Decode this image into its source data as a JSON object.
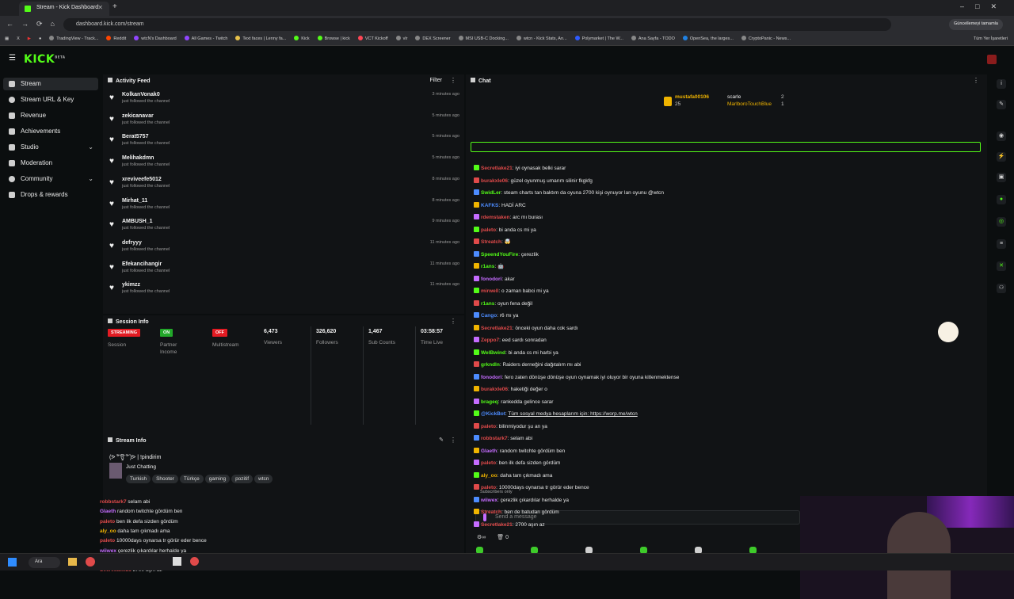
{
  "browser": {
    "tabs": [
      {
        "title": "Stream - Kick Dashboard"
      },
      {
        "title": "wtcN's Dashboard"
      }
    ],
    "url": "dashboard.kick.com/stream",
    "update_label": "Güncellemeyi tamamla",
    "bookmarks": [
      "TradingView - Track...",
      "Reddit",
      "wtcN's Dashboard",
      "All Games - Twitch",
      "Text faces | Lenny fa...",
      "Kick",
      "Browse | kick",
      "VCT Kickoff",
      "vlr",
      "DEX Screener",
      "MSI USB-C Docking...",
      "wtcn - Kick Stats, An...",
      "Polymarket | The W...",
      "Ana Sayfa - TODO",
      "OpenSea, the larges...",
      "CryptoPanic - News..."
    ],
    "all_bookmarks": "Tüm Yer İşaretleri"
  },
  "app": {
    "logo": "KICK",
    "logo_sup": "BETA"
  },
  "sidebar": {
    "items": [
      {
        "label": "Stream",
        "active": true
      },
      {
        "label": "Stream URL & Key"
      },
      {
        "label": "Revenue"
      },
      {
        "label": "Achievements"
      },
      {
        "label": "Studio",
        "chevron": true
      },
      {
        "label": "Moderation"
      },
      {
        "label": "Community",
        "chevron": true
      },
      {
        "label": "Drops & rewards"
      }
    ]
  },
  "activity": {
    "title": "Activity Feed",
    "filter": "Filter",
    "items": [
      {
        "name": "KolkanVonak0",
        "sub": "just followed the channel",
        "time": "3 minutes ago"
      },
      {
        "name": "zekicanavar",
        "sub": "just followed the channel",
        "time": "5 minutes ago"
      },
      {
        "name": "Berat5757",
        "sub": "just followed the channel",
        "time": "5 minutes ago"
      },
      {
        "name": "Melihakdmn",
        "sub": "just followed the channel",
        "time": "5 minutes ago"
      },
      {
        "name": "xreviveefe5012",
        "sub": "just followed the channel",
        "time": "8 minutes ago"
      },
      {
        "name": "Mirhat_11",
        "sub": "just followed the channel",
        "time": "8 minutes ago"
      },
      {
        "name": "AMBUSH_1",
        "sub": "just followed the channel",
        "time": "9 minutes ago"
      },
      {
        "name": "defryyy",
        "sub": "just followed the channel",
        "time": "11 minutes ago"
      },
      {
        "name": "Efekancihangir",
        "sub": "just followed the channel",
        "time": "11 minutes ago"
      },
      {
        "name": "ykimzz",
        "sub": "just followed the channel",
        "time": "11 minutes ago"
      }
    ]
  },
  "session": {
    "title": "Session Info",
    "stats": [
      {
        "badge": "STREAMING",
        "label": "Session",
        "color": "#e31b23"
      },
      {
        "badge": "ON",
        "label": "Partner Income",
        "color": "#22a82a"
      },
      {
        "badge": "OFF",
        "label": "Multistream",
        "color": "#e31b23"
      },
      {
        "value": "6,473",
        "label": "Viewers"
      },
      {
        "value": "326,620",
        "label": "Followers"
      },
      {
        "value": "1,467",
        "label": "Sub Counts"
      },
      {
        "value": "03:58:57",
        "label": "Time Live"
      }
    ]
  },
  "stream_info": {
    "title": "Stream Info",
    "stream_title": "(ᕗ ͠° ਊ ͠° )ᕗ | !pindirim",
    "category": "Just Chatting",
    "tags": [
      "Turkish",
      "Shooter",
      "Türkçe",
      "gaming",
      "pozitif",
      "wtcn"
    ]
  },
  "overlay_chat": [
    {
      "user": "robbstark7",
      "text": "selam abi",
      "color": "#e04a4a"
    },
    {
      "user": "Glaeth",
      "text": "random twitchte gördüm ben",
      "color": "#c56cff"
    },
    {
      "user": "paleto",
      "text": "ben ilk defa sizden gördüm",
      "color": "#e04a4a"
    },
    {
      "user": "aly_oo",
      "text": "daha tam çıkmadı ama",
      "color": "#f0b400"
    },
    {
      "user": "paleto",
      "text": "10000days oynarsa tr görür eder bence",
      "color": "#e04a4a"
    },
    {
      "user": "wiiwex",
      "text": "çerezlik çıkardılar herhalde ya",
      "color": "#c56cff"
    },
    {
      "user": "Streatch",
      "text": "ben de batudan gördüm",
      "color": "#e04a4a"
    },
    {
      "user": "Secretlake21",
      "text": "2700 aşın az",
      "color": "#e04a4a"
    }
  ],
  "chat": {
    "title": "Chat",
    "top_gifters": [
      {
        "name": "mustafa00106",
        "count": "25"
      },
      {
        "name": "scarle",
        "count": "2"
      },
      {
        "name": "MarlboroTouchBlue",
        "count": "1"
      }
    ],
    "messages": [
      {
        "user": "Secretlake21",
        "text": "iyi oynasak belki sarar",
        "color": "#e04a4a"
      },
      {
        "user": "burakxle06",
        "text": "güzel oyunmuş umarım silinir fkgkfg",
        "color": "#e04a4a"
      },
      {
        "user": "SwidLer",
        "text": "steam charts tan baktım da oyuna 2700 kişi oynuyor lan oyunu @wtcn",
        "color": "#53fc18",
        "highlight": true
      },
      {
        "user": "KAFKS",
        "text": "HADİ ARC",
        "color": "#4d8cff"
      },
      {
        "user": "rdemstaken",
        "text": "arc mı burası",
        "color": "#e04a4a"
      },
      {
        "user": "paleto",
        "text": "bi anda cs mi ya",
        "color": "#e04a4a"
      },
      {
        "user": "Streatch",
        "text": "🤯",
        "color": "#e04a4a"
      },
      {
        "user": "SpeendYouFire",
        "text": "çerezlik",
        "color": "#53fc18"
      },
      {
        "user": "r1ans",
        "text": "🤖",
        "color": "#53fc18"
      },
      {
        "user": "fonodori",
        "text": "akar",
        "color": "#c56cff"
      },
      {
        "user": "mirwell",
        "text": "o zaman babci mi ya",
        "color": "#e04a4a"
      },
      {
        "user": "r1ans",
        "text": "oyun fena değil",
        "color": "#53fc18"
      },
      {
        "user": "Cango",
        "text": "r6 mı ya",
        "color": "#4d8cff"
      },
      {
        "user": "Secretlake21",
        "text": "önceki oyun daha cok sardı",
        "color": "#e04a4a"
      },
      {
        "user": "Zeppo7",
        "text": "eed sardı sonradan",
        "color": "#e04a4a"
      },
      {
        "user": "WelBwind",
        "text": "bi anda cs mi harbi ya",
        "color": "#53fc18"
      },
      {
        "user": "grkndln",
        "text": "Raiders derneğini dağıtalım mı abi",
        "color": "#53fc18"
      },
      {
        "user": "fonodori",
        "text": "fero zaten dönüşe dönüşe oyun oynamak iyi oluyor bir oyuna kitlenmektense",
        "color": "#c56cff"
      },
      {
        "user": "burakxle06",
        "text": "haketiği değer o",
        "color": "#e04a4a"
      },
      {
        "user": "brageq",
        "text": "rankedda gelince sarar",
        "color": "#53fc18"
      },
      {
        "user": "@KickBot",
        "text": "Tüm sosyal medya hesaplarım için: https://worp.me/wtcn",
        "color": "#4d8cff",
        "link": true
      },
      {
        "user": "paleto",
        "text": "bilinmiyodur şu an ya",
        "color": "#e04a4a"
      },
      {
        "user": "robbstark7",
        "text": "selam abi",
        "color": "#e04a4a"
      },
      {
        "user": "Glaeth",
        "text": "random twitchte gördüm ben",
        "color": "#c56cff"
      },
      {
        "user": "paleto",
        "text": "ben ilk defa sizden gördüm",
        "color": "#e04a4a"
      },
      {
        "user": "aly_oo",
        "text": "daha tam çıkmadı ama",
        "color": "#f0b400"
      },
      {
        "user": "paleto",
        "text": "10000days oynarsa tr görür eder bence",
        "color": "#e04a4a"
      },
      {
        "user": "wiiwex",
        "text": "çerezlik çıkardılar herhalde ya",
        "color": "#c56cff"
      },
      {
        "user": "Streatch",
        "text": "ben de batudan gördüm",
        "color": "#e04a4a"
      },
      {
        "user": "Secretlake21",
        "text": "2700 aşın az",
        "color": "#e04a4a"
      }
    ],
    "subscribers_only": "Subscribers only",
    "input_placeholder": "Send a message",
    "footer_count": "0"
  },
  "taskbar": {
    "search": "Ara"
  }
}
